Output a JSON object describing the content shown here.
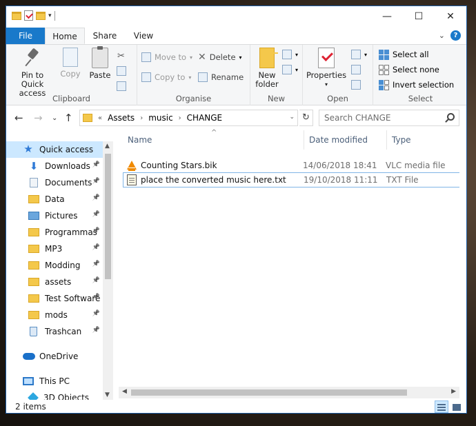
{
  "titlebar": {
    "minimize": "—",
    "maximize": "☐",
    "close": "✕"
  },
  "tabs": {
    "file": "File",
    "home": "Home",
    "share": "Share",
    "view": "View",
    "expand": "⌄",
    "help": "?"
  },
  "ribbon": {
    "clipboard": {
      "label": "Clipboard",
      "pin": "Pin to Quick access",
      "copy": "Copy",
      "paste": "Paste"
    },
    "organise": {
      "label": "Organise",
      "move_to": "Move to",
      "copy_to": "Copy to",
      "delete": "Delete",
      "rename": "Rename"
    },
    "new": {
      "label": "New",
      "new_folder": "New folder"
    },
    "open": {
      "label": "Open",
      "properties": "Properties"
    },
    "select": {
      "label": "Select",
      "select_all": "Select all",
      "select_none": "Select none",
      "invert": "Invert selection"
    }
  },
  "address": {
    "chevrons": "«",
    "crumbs": [
      "Assets",
      "music",
      "CHANGE"
    ],
    "separator": "›",
    "search_placeholder": "Search CHANGE"
  },
  "nav": {
    "quick_access": "Quick access",
    "items": [
      {
        "label": "Downloads",
        "icon": "download-icon"
      },
      {
        "label": "Documents",
        "icon": "documents-icon"
      },
      {
        "label": "Data",
        "icon": "folder-icon"
      },
      {
        "label": "Pictures",
        "icon": "pictures-icon"
      },
      {
        "label": "Programmas",
        "icon": "folder-icon"
      },
      {
        "label": "MP3",
        "icon": "folder-icon"
      },
      {
        "label": "Modding",
        "icon": "folder-icon"
      },
      {
        "label": "assets",
        "icon": "folder-icon"
      },
      {
        "label": "Test Software",
        "icon": "folder-icon"
      },
      {
        "label": "mods",
        "icon": "folder-icon"
      },
      {
        "label": "Trashcan",
        "icon": "recycle-bin-icon"
      }
    ],
    "onedrive": "OneDrive",
    "this_pc": "This PC",
    "objects_3d": "3D Objects"
  },
  "columns": {
    "name": "Name",
    "date": "Date modified",
    "type": "Type"
  },
  "files": [
    {
      "name": "Counting Stars.bik",
      "date": "14/06/2018 18:41",
      "type": "VLC media file"
    },
    {
      "name": "place the converted music here.txt",
      "date": "19/10/2018 11:11",
      "type": "TXT File"
    }
  ],
  "status": {
    "count": "2 items"
  }
}
